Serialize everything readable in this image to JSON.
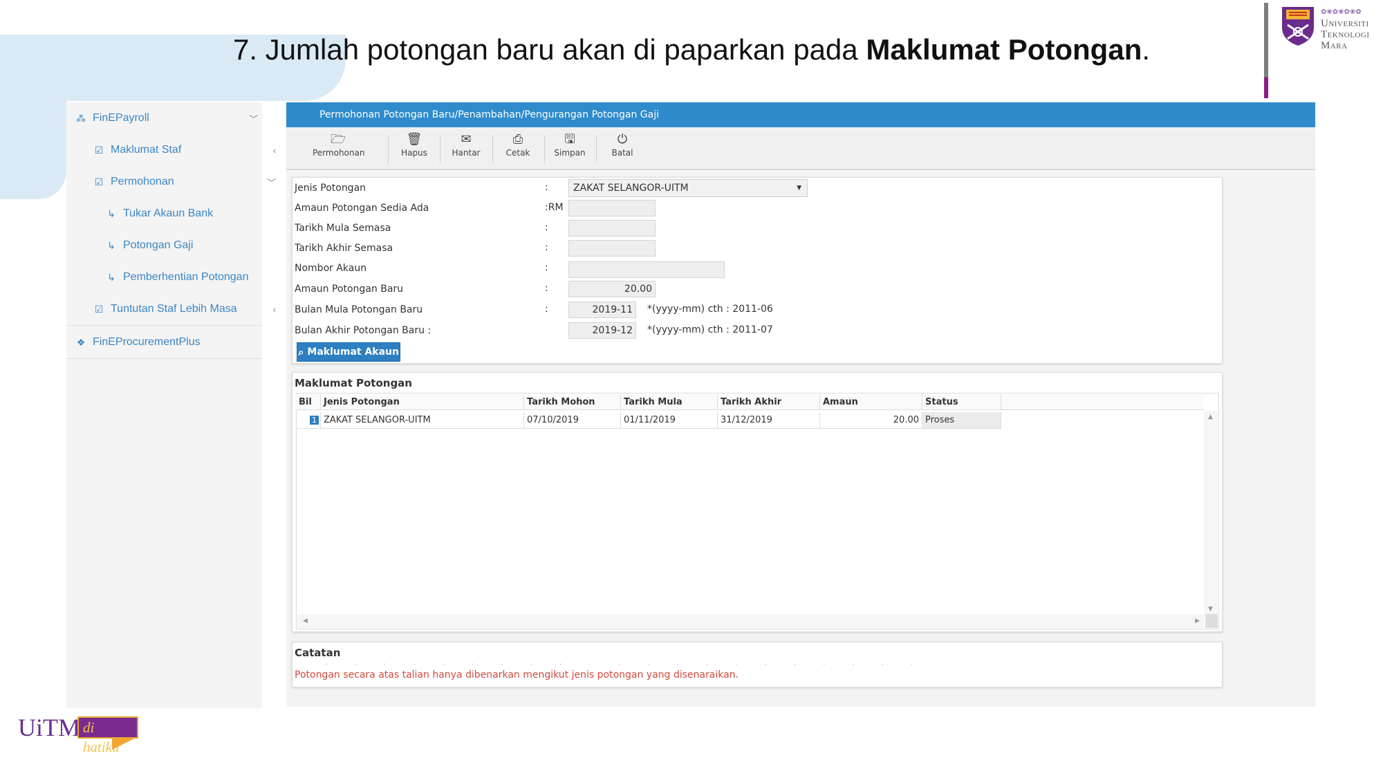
{
  "slide": {
    "title_prefix": "7. Jumlah potongan baru akan di paparkan pada ",
    "title_bold": "Maklumat Potongan",
    "title_suffix": "."
  },
  "logo": {
    "line1": "Universiti",
    "line2": "Teknologi",
    "line3": "Mara"
  },
  "brand": {
    "main": "UiTM",
    "tag": "di hatiku"
  },
  "sidebar": {
    "items": [
      {
        "label": "FinEPayroll",
        "icon": "sitemap-icon",
        "chevron": "﹀"
      },
      {
        "label": "Maklumat Staf",
        "icon": "check-square-icon",
        "chevron": "‹"
      },
      {
        "label": "Permohonan",
        "icon": "check-square-icon",
        "chevron": "﹀"
      },
      {
        "label": "Tukar Akaun Bank",
        "icon": "arrow-return-icon"
      },
      {
        "label": "Potongan Gaji",
        "icon": "arrow-return-icon"
      },
      {
        "label": "Pemberhentian Potongan",
        "icon": "arrow-return-icon"
      },
      {
        "label": "Tuntutan Staf Lebih Masa",
        "icon": "check-square-icon",
        "chevron": "‹"
      },
      {
        "label": "FinEProcurementPlus",
        "icon": "cubes-icon"
      }
    ]
  },
  "panel": {
    "title": "Permohonan Potongan Baru/Penambahan/Pengurangan Potongan Gaji"
  },
  "toolbar": {
    "buttons": [
      {
        "label": "Permohonan",
        "icon": "folder-open-icon"
      },
      {
        "label": "Hapus",
        "icon": "trash-icon"
      },
      {
        "label": "Hantar",
        "icon": "envelope-icon"
      },
      {
        "label": "Cetak",
        "icon": "print-icon"
      },
      {
        "label": "Simpan",
        "icon": "save-icon"
      },
      {
        "label": "Batal",
        "icon": "power-icon"
      }
    ]
  },
  "form": {
    "jenis_label": "Jenis Potongan",
    "jenis_value": "ZAKAT SELANGOR-UITM",
    "amaun_sedia_label": "Amaun Potongan Sedia Ada",
    "amaun_sedia_prefix": ":RM",
    "amaun_sedia_value": "",
    "mula_semasa_label": "Tarikh Mula Semasa",
    "mula_semasa_value": "",
    "akhir_semasa_label": "Tarikh Akhir Semasa",
    "akhir_semasa_value": "",
    "nombor_akaun_label": "Nombor Akaun",
    "nombor_akaun_value": "",
    "amaun_baru_label": "Amaun Potongan Baru",
    "amaun_baru_value": "20.00",
    "bulan_mula_label": "Bulan Mula Potongan Baru",
    "bulan_mula_value": "2019-11",
    "bulan_mula_hint": "*(yyyy-mm) cth : 2011-06",
    "bulan_akhir_label": "Bulan Akhir Potongan Baru :",
    "bulan_akhir_value": "2019-12",
    "bulan_akhir_hint": "*(yyyy-mm) cth : 2011-07",
    "colon": ":",
    "maklumat_akaun_button": "Maklumat Akaun"
  },
  "potongan": {
    "title": "Maklumat Potongan",
    "headers": [
      "Bil",
      "Jenis Potongan",
      "Tarikh Mohon",
      "Tarikh Mula",
      "Tarikh Akhir",
      "Amaun",
      "Status"
    ],
    "rows": [
      {
        "bil": "1",
        "jenis": "ZAKAT SELANGOR-UITM",
        "mohon": "07/10/2019",
        "mula": "01/11/2019",
        "akhir": "31/12/2019",
        "amaun": "20.00",
        "status": "Proses"
      }
    ]
  },
  "catatan": {
    "title": "Catatan",
    "note": "Potongan secara atas talian hanya dibenarkan mengikut jenis potongan yang disenaraikan."
  },
  "colors": {
    "header_blue": "#2f8bcc",
    "link_blue": "#3b86c4",
    "note_red": "#d04a3c"
  }
}
